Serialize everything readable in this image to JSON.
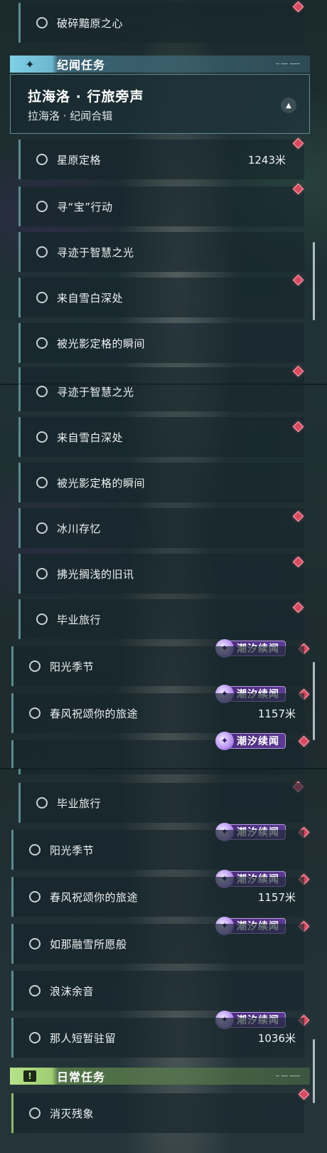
{
  "sections": {
    "story": {
      "title": "纪闻任务",
      "icon": "sparkle-icon",
      "color": "#7fd0e8"
    },
    "daily": {
      "title": "日常任务",
      "icon": "exclamation-box-icon",
      "color": "#b6e28a"
    }
  },
  "chapter": {
    "title": "拉海洛 · 行旅旁声",
    "subtitle": "拉海洛 · 纪闻合辑"
  },
  "badge_label": "潮汐续闻",
  "panel1": {
    "top_row": "破碎黯原之心",
    "quests": [
      {
        "name": "星原定格",
        "distance": "1243米"
      },
      {
        "name": "寻“宝”行动"
      },
      {
        "name": "寻迹于智慧之光"
      },
      {
        "name": "来自雪白深处"
      },
      {
        "name": "被光影定格的瞬间"
      }
    ]
  },
  "panel2": {
    "quests": [
      {
        "name": "寻迹于智慧之光"
      },
      {
        "name": "来自雪白深处"
      },
      {
        "name": "被光影定格的瞬间"
      },
      {
        "name": "冰川存忆"
      },
      {
        "name": "拂光搁浅的旧讯"
      },
      {
        "name": "毕业旅行"
      },
      {
        "name": "阳光季节"
      },
      {
        "name": "春风祝颂你的旅途",
        "distance": "1157米"
      }
    ]
  },
  "panel3": {
    "quests": [
      {
        "name": "毕业旅行"
      },
      {
        "name": "阳光季节"
      },
      {
        "name": "春风祝颂你的旅途",
        "distance": "1157米"
      },
      {
        "name": "如那融雪所愿般"
      },
      {
        "name": "浪沫余音"
      },
      {
        "name": "那人短暂驻留",
        "distance": "1036米"
      }
    ],
    "daily": [
      {
        "name": "消灭残象"
      }
    ]
  },
  "colors": {
    "accent_blue": "#7fd0e8",
    "accent_green": "#b6e28a",
    "marker_red": "#d94a60",
    "badge_purple": "#5c3a92"
  }
}
